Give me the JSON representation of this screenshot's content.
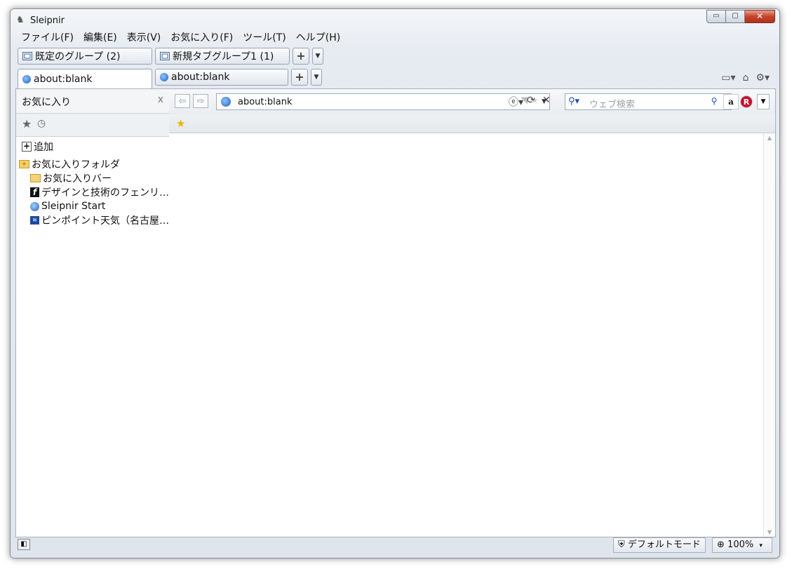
{
  "window": {
    "title": "Sleipnir",
    "buttons": {
      "minimize": "▭",
      "maximize": "▢",
      "close": "✕"
    }
  },
  "menu": [
    "ファイル(F)",
    "編集(E)",
    "表示(V)",
    "お気に入り(F)",
    "ツール(T)",
    "ヘルプ(H)"
  ],
  "groups": [
    {
      "label": "既定のグループ (2)"
    },
    {
      "label": "新規タブグループ1 (1)"
    }
  ],
  "tabs": [
    {
      "label": "about:blank",
      "active": true
    },
    {
      "label": "about:blank",
      "active": false
    }
  ],
  "sidebar": {
    "title": "お気に入り",
    "close": "x",
    "add_label": "追加",
    "items": [
      {
        "label": "お気に入りフォルダ",
        "icon": "favorites-folder-icon",
        "level": 0
      },
      {
        "label": "お気に入りバー",
        "icon": "folder-icon",
        "level": 1
      },
      {
        "label": "デザインと技術のフェンリ…",
        "icon": "fenrir-logo-icon",
        "level": 1
      },
      {
        "label": "Sleipnir Start",
        "icon": "globe-icon",
        "level": 1
      },
      {
        "label": "ピンポイント天気（名古屋…",
        "icon": "weather-site-icon",
        "level": 1
      }
    ]
  },
  "address": {
    "url": "about:blank"
  },
  "search": {
    "placeholder": "ウェブ検索",
    "engines": [
      "a",
      "R"
    ]
  },
  "status": {
    "mode": "デフォルトモード",
    "zoom": "100%"
  }
}
